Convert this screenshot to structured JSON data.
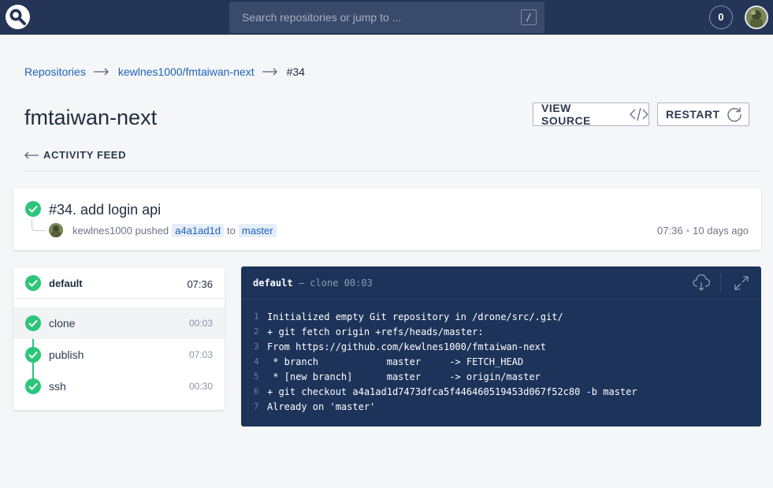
{
  "header": {
    "search_placeholder": "Search repositories or jump to ...",
    "search_shortcut": "/",
    "notification_count": "0"
  },
  "breadcrumb": {
    "root": "Repositories",
    "repo": "kewlnes1000/fmtaiwan-next",
    "current": "#34"
  },
  "page": {
    "title": "fmtaiwan-next",
    "view_source_label": "VIEW SOURCE",
    "restart_label": "RESTART",
    "back_label": "ACTIVITY FEED"
  },
  "build": {
    "title": "#34. add login api",
    "author": "kewlnes1000",
    "action": "pushed",
    "commit": "a4a1ad1d",
    "to_word": "to",
    "branch": "master",
    "time": "07:36",
    "ago": "10 days ago"
  },
  "stage": {
    "name": "default",
    "duration": "07:36",
    "steps": [
      {
        "name": "clone",
        "duration": "00:03",
        "active": true
      },
      {
        "name": "publish",
        "duration": "07:03",
        "active": false
      },
      {
        "name": "ssh",
        "duration": "00:30",
        "active": false
      }
    ]
  },
  "log": {
    "stage": "default",
    "separator": "—",
    "step": "clone",
    "duration": "00:03",
    "lines": [
      {
        "num": "1",
        "text": "Initialized empty Git repository in /drone/src/.git/"
      },
      {
        "num": "2",
        "text": "+ git fetch origin +refs/heads/master:"
      },
      {
        "num": "3",
        "text": "From https://github.com/kewlnes1000/fmtaiwan-next"
      },
      {
        "num": "4",
        "text": " * branch            master     -> FETCH_HEAD"
      },
      {
        "num": "5",
        "text": " * [new branch]      master     -> origin/master"
      },
      {
        "num": "6",
        "text": "+ git checkout a4a1ad1d7473dfca5f446460519453d067f52c80 -b master"
      },
      {
        "num": "7",
        "text": "Already on 'master'"
      }
    ]
  },
  "colors": {
    "topbar": "#253557",
    "success": "#2dc57b",
    "link": "#1e62b9",
    "log_bg": "#1d3359"
  }
}
